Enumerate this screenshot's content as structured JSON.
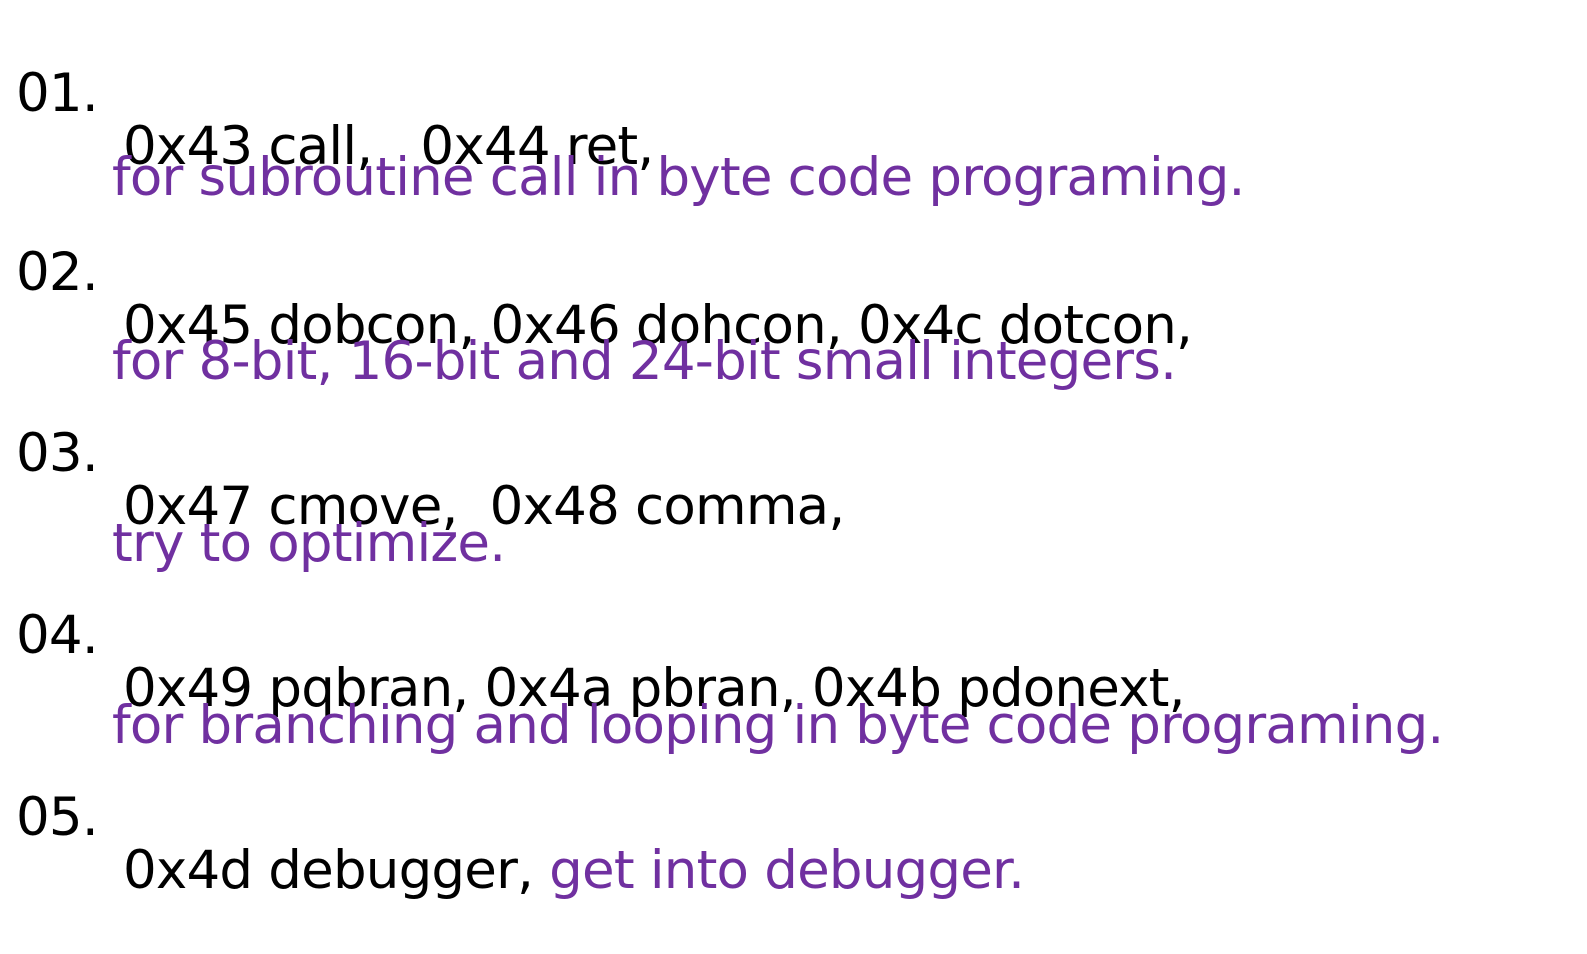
{
  "colors": {
    "text": "#000000",
    "description": "#7030a0",
    "background": "#ffffff"
  },
  "items": [
    {
      "number": "01.",
      "code": "0x43 call,   0x44 ret,",
      "description": "for subroutine call in byte code programing."
    },
    {
      "number": "02.",
      "code": "0x45 dobcon, 0x46 dohcon, 0x4c dotcon,",
      "description": "for 8-bit, 16-bit and 24-bit small integers."
    },
    {
      "number": "03.",
      "code": "0x47 cmove,  0x48 comma,",
      "description": "try to optimize."
    },
    {
      "number": "04.",
      "code": "0x49 pqbran, 0x4a pbran, 0x4b pdonext,",
      "description": "for branching and looping in byte code programing."
    },
    {
      "number": "05.",
      "code": "0x4d debugger,",
      "description": "get into debugger."
    }
  ]
}
